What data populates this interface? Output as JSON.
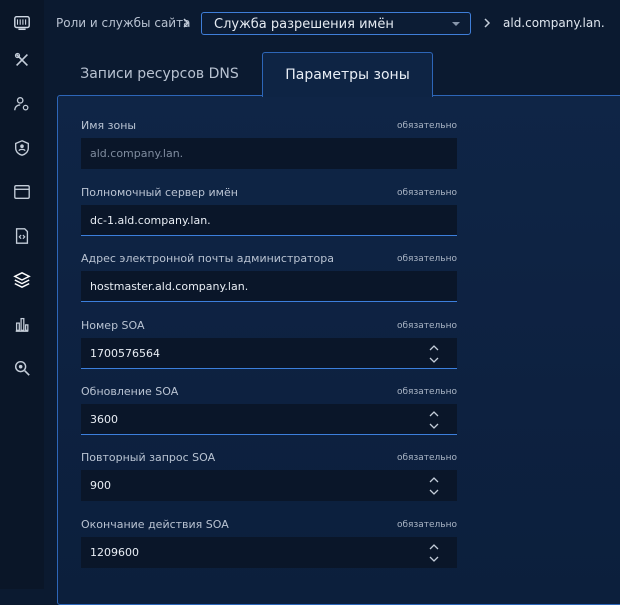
{
  "sidebar": {
    "icons": [
      "monitor-logo-icon",
      "tools-icon",
      "user-settings-icon",
      "shield-user-icon",
      "window-icon",
      "code-file-icon",
      "layers-icon",
      "bar-chart-icon",
      "zoom-search-icon"
    ]
  },
  "breadcrumb": {
    "root": "Роли и службы сайта",
    "service": "Служба разрешения имён",
    "zone": "ald.company.lan."
  },
  "tabs": {
    "records": "Записи ресурсов DNS",
    "params": "Параметры зоны",
    "active": "params"
  },
  "form": {
    "required_label": "обязательно",
    "zone_name": {
      "label": "Имя зоны",
      "value": "ald.company.lan."
    },
    "primary_ns": {
      "label": "Полномочный сервер имён",
      "value": "dc-1.ald.company.lan."
    },
    "admin_email": {
      "label": "Адрес электронной почты администратора",
      "value": "hostmaster.ald.company.lan."
    },
    "soa_serial": {
      "label": "Номер SOA",
      "value": "1700576564"
    },
    "soa_refresh": {
      "label": "Обновление SOA",
      "value": "3600"
    },
    "soa_retry": {
      "label": "Повторный запрос SOA",
      "value": "900"
    },
    "soa_expire": {
      "label": "Окончание действия SOA",
      "value": "1209600"
    }
  },
  "colors": {
    "accent": "#3f7ed8",
    "background": "#0b1a30",
    "input_bg": "#0a1629"
  }
}
